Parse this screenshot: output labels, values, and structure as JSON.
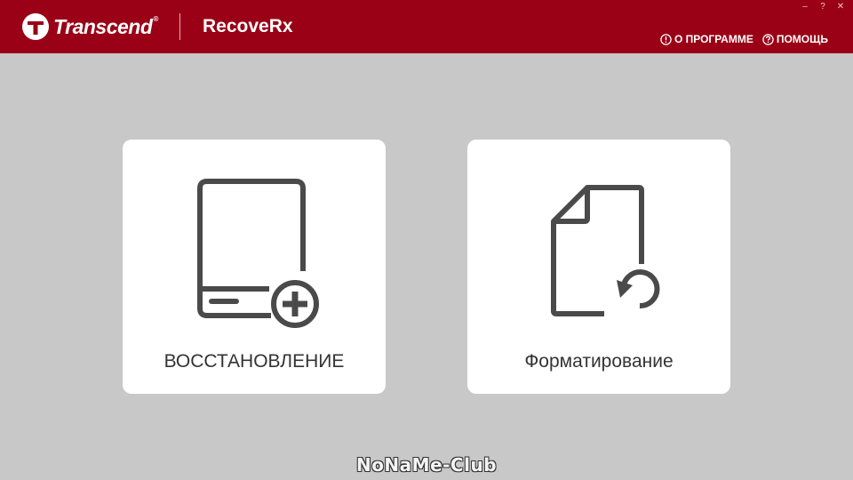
{
  "header": {
    "brand": "Transcend",
    "brand_reg": "®",
    "app_title": "RecoveRx",
    "links": {
      "about": "О ПРОГРАММЕ",
      "help": "ПОМОЩЬ"
    },
    "window_controls": {
      "minimize": "–",
      "help": "?",
      "close": "✕"
    }
  },
  "cards": {
    "recover": {
      "label": "ВОССТАНОВЛЕНИЕ",
      "icon": "drive-add-icon"
    },
    "format": {
      "label": "Форматирование",
      "icon": "file-restore-icon"
    }
  },
  "watermark": "NoNaMe-Club",
  "colors": {
    "header_bg": "#9a0016",
    "page_bg": "#c8c8c8",
    "card_bg": "#ffffff",
    "icon": "#4a4a4a"
  }
}
